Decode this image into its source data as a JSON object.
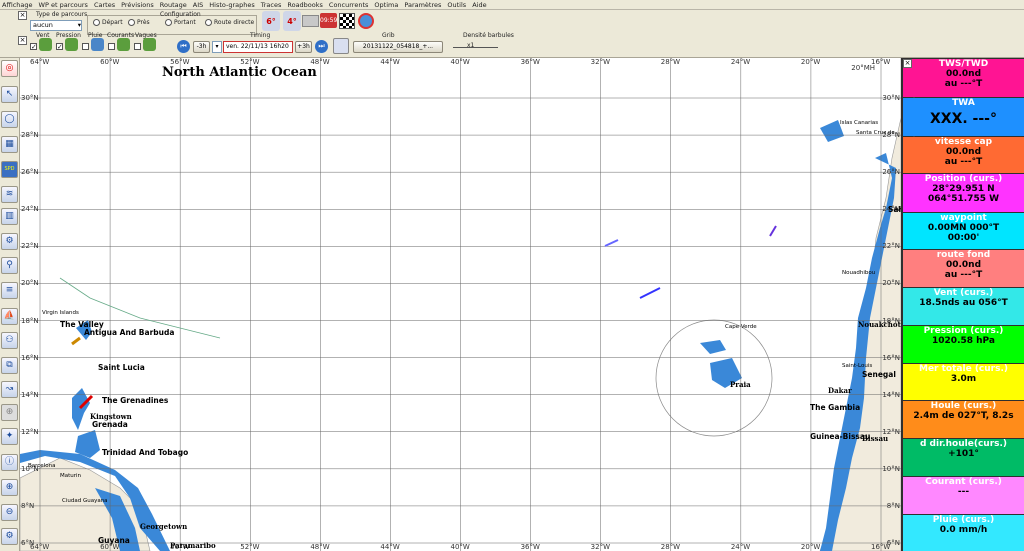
{
  "menu": [
    "Affichage",
    "WP et parcours",
    "Cartes",
    "Prévisions",
    "Routage",
    "AIS",
    "Histo-graphes",
    "Traces",
    "Roadbooks",
    "Concurrents",
    "Optima",
    "Paramètres",
    "Outils",
    "Aide"
  ],
  "toolbar": {
    "type_parcours_label": "Type de parcours",
    "type_parcours_value": "aucun",
    "configuration_label": "Configuration",
    "radio_depart": "Départ",
    "radio_pres": "Près",
    "radio_portant": "Portant",
    "radio_route_directe": "Route directe",
    "deg_left": "6°",
    "deg_right": "4°",
    "chrono": "09:59",
    "vent_label": "Vent",
    "pression_label": "Pression",
    "pluie_label": "Pluie",
    "courants_label": "Courants",
    "vagues_label": "Vagues",
    "timing_label": "Timing",
    "minus3h": "-3h",
    "datetime": "ven. 22/11/13 16h20",
    "plus3h": "+3h",
    "grib_label": "Grib",
    "grib_file": "20131122_054818_+...",
    "densite_label": "Densité barbules",
    "densite_value": "x1"
  },
  "map": {
    "ocean_title": "North Atlantic Ocean",
    "lon_labels": [
      "64°W",
      "60°W",
      "56°W",
      "52°W",
      "48°W",
      "44°W",
      "40°W",
      "36°W",
      "32°W",
      "28°W",
      "24°W",
      "20°W",
      "16°W"
    ],
    "lat_labels": [
      "30°N",
      "28°N",
      "26°N",
      "24°N",
      "22°N",
      "20°N",
      "18°N",
      "16°N",
      "14°N",
      "12°N",
      "10°N",
      "8°N",
      "6°N"
    ],
    "top_right_lbl": "20°MH",
    "places": [
      {
        "name": "Virgin Islands",
        "size": "small"
      },
      {
        "name": "The Valley",
        "size": "big"
      },
      {
        "name": "Antigua And Barbuda",
        "size": "big"
      },
      {
        "name": "Saint Lucia",
        "size": "big"
      },
      {
        "name": "The Grenadines",
        "size": "big"
      },
      {
        "name": "Kingstown",
        "size": "city"
      },
      {
        "name": "Grenada",
        "size": "big"
      },
      {
        "name": "Trinidad And Tobago",
        "size": "big"
      },
      {
        "name": "Barcelona",
        "size": "small"
      },
      {
        "name": "Maturin",
        "size": "small"
      },
      {
        "name": "Ciudad Guayana",
        "size": "small"
      },
      {
        "name": "Georgetown",
        "size": "city"
      },
      {
        "name": "Guyana",
        "size": "big"
      },
      {
        "name": "Paramaribo",
        "size": "city"
      },
      {
        "name": "Cape Verde",
        "size": "small"
      },
      {
        "name": "Praia",
        "size": "city"
      },
      {
        "name": "Senegal",
        "size": "big"
      },
      {
        "name": "Dakar",
        "size": "city"
      },
      {
        "name": "The Gambia",
        "size": "big"
      },
      {
        "name": "Guinea-Bissau",
        "size": "big"
      },
      {
        "name": "Bissau",
        "size": "city"
      },
      {
        "name": "Nouakchott",
        "size": "city"
      },
      {
        "name": "Nouadhibou",
        "size": "small"
      },
      {
        "name": "Saint-Louis",
        "size": "small"
      },
      {
        "name": "Santa Cruz de...",
        "size": "small"
      },
      {
        "name": "Islas Canarias",
        "size": "small"
      },
      {
        "name": "Sah",
        "size": "big"
      }
    ]
  },
  "panel": [
    {
      "title": "TWS/TWD",
      "lines": [
        "00.0nd",
        "au ---°T"
      ],
      "color": "#ff1493"
    },
    {
      "title": "TWA",
      "lines": [
        "XXX.  ---°"
      ],
      "color": "#1e90ff"
    },
    {
      "title": "vitesse cap",
      "lines": [
        "00.0nd",
        "au ---°T"
      ],
      "color": "#ff6a33"
    },
    {
      "title": "Position (curs.)",
      "lines": [
        "28°29.951 N",
        "064°51.755 W"
      ],
      "color": "#ff33ff"
    },
    {
      "title": "waypoint",
      "lines": [
        "0.00MN 000°T",
        "00:00'"
      ],
      "color": "#00e5ff"
    },
    {
      "title": "route fond",
      "lines": [
        "00.0nd",
        "au ---°T"
      ],
      "color": "#ff7f7f"
    },
    {
      "title": "Vent (curs.)",
      "lines": [
        "18.5nds au 056°T"
      ],
      "color": "#33e8e8"
    },
    {
      "title": "Pression (curs.)",
      "lines": [
        "1020.58 hPa"
      ],
      "color": "#00ff00"
    },
    {
      "title": "Mer totale (curs.)",
      "lines": [
        "3.0m"
      ],
      "color": "#ffff00"
    },
    {
      "title": "Houle (curs.)",
      "lines": [
        "2.4m de 027°T, 8.2s"
      ],
      "color": "#ff8c1a"
    },
    {
      "title": "d dir.houle(curs.)",
      "lines": [
        "+101°"
      ],
      "color": "#00bb66"
    },
    {
      "title": "Courant (curs.)",
      "lines": [
        "---"
      ],
      "color": "#ff88ff"
    },
    {
      "title": "Pluie (curs.)",
      "lines": [
        "0.0 mm/h"
      ],
      "color": "#33e8ff"
    }
  ]
}
